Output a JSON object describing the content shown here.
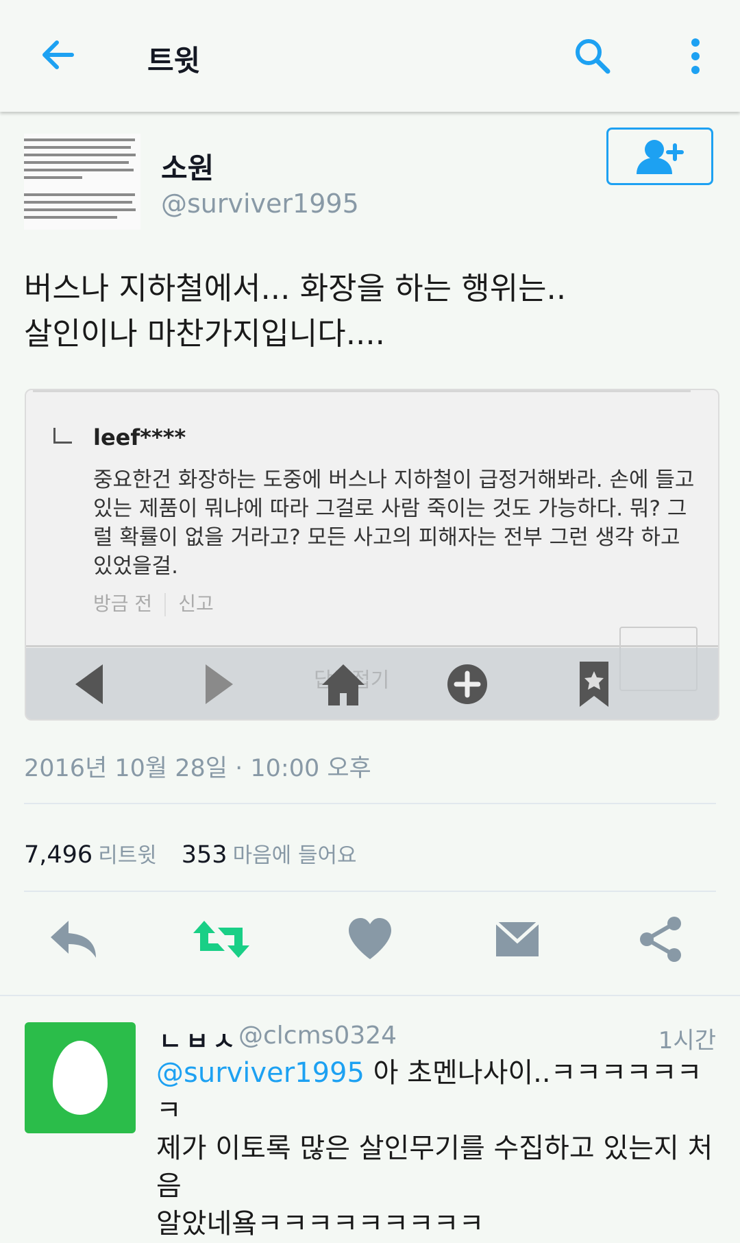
{
  "header": {
    "title": "트윗",
    "icons": [
      "back-arrow-icon",
      "search-icon",
      "more-vertical-icon"
    ],
    "accent_color": "#1da1f2"
  },
  "author": {
    "display_name": "소원",
    "handle": "@surviver1995",
    "follow_icon": "add-user-icon"
  },
  "tweet": {
    "text_line1": "버스나 지하철에서... 화장을 하는 행위는..",
    "text_line2": "살인이나 마찬가지입니다....",
    "datetime": "2016년 10월 28일 · 10:00 오후",
    "retweets": "7,496",
    "retweets_label": "리트윗",
    "likes": "353",
    "likes_label": "마음에 들어요"
  },
  "embedded_comment": {
    "username": "leef****",
    "body": "중요한건 화장하는 도중에 버스나 지하철이 급정거해봐라. 손에 들고있는 제품이 뭐냐에 따라 그걸로 사람 죽이는 것도 가능하다. 뭐? 그럴 확률이 없을 거라고? 모든 사고의 피해자는 전부 그런 생각 하고 있었을걸.",
    "time": "방금 전",
    "report": "신고",
    "faded_label": "답글접기",
    "browser_icons": [
      "left-triangle-icon",
      "right-triangle-icon",
      "home-icon",
      "plus-circle-icon",
      "bookmark-star-icon"
    ]
  },
  "actions": [
    "reply-icon",
    "retweet-icon",
    "heart-icon",
    "message-icon",
    "share-icon"
  ],
  "reply": {
    "name": "ㄴㅂㅅ",
    "handle": "@clcms0324",
    "time": "1시간",
    "mention": "@surviver1995",
    "text_line1": " 아 초멘나사이..ㅋㅋㅋㅋㅋㅋㅋ",
    "text_line2": "제가 이토록 많은 살인무기를 수집하고 있는지 처음",
    "text_line3": "알았네욬ㅋㅋㅋㅋㅋㅋㅋㅋㅋ",
    "avatar_color": "#2bbd4a"
  }
}
